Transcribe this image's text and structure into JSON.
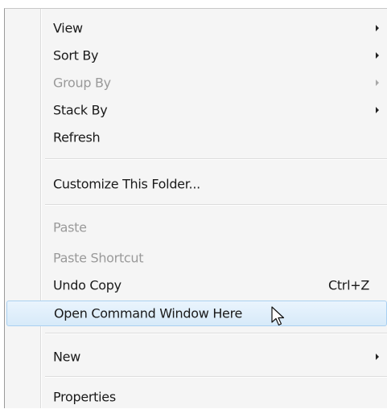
{
  "menu": {
    "items": [
      {
        "label": "View",
        "submenu": true,
        "disabled": false
      },
      {
        "label": "Sort By",
        "submenu": true,
        "disabled": false
      },
      {
        "label": "Group By",
        "submenu": true,
        "disabled": true
      },
      {
        "label": "Stack By",
        "submenu": true,
        "disabled": false
      },
      {
        "label": "Refresh",
        "submenu": false,
        "disabled": false
      },
      {
        "label": "Customize This Folder...",
        "submenu": false,
        "disabled": false
      },
      {
        "label": "Paste",
        "submenu": false,
        "disabled": true
      },
      {
        "label": "Paste Shortcut",
        "submenu": false,
        "disabled": true
      },
      {
        "label": "Undo Copy",
        "shortcut": "Ctrl+Z",
        "submenu": false,
        "disabled": false
      },
      {
        "label": "Open Command Window Here",
        "submenu": false,
        "disabled": false,
        "highlighted": true
      },
      {
        "label": "New",
        "submenu": true,
        "disabled": false
      },
      {
        "label": "Properties",
        "submenu": false,
        "disabled": false
      }
    ]
  },
  "colors": {
    "highlight_border": "#a9d0f1",
    "highlight_fill": "#d7eaf9",
    "disabled_text": "#9a9a9a",
    "menu_background": "#f5f5f5"
  }
}
